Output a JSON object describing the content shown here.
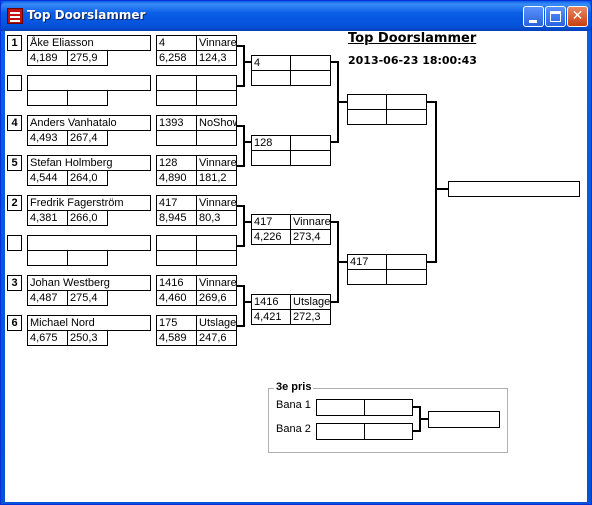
{
  "window": {
    "title": "Top Doorslammer"
  },
  "header": {
    "title": "Top Doorslammer",
    "timestamp": "2013-06-23 18:00:43"
  },
  "round1": [
    {
      "seed": "1",
      "name": "Åke Eliasson",
      "rt": "4,189",
      "et": "275,9",
      "result_a": "4",
      "result_b": "Vinnare",
      "result_c": "6,258",
      "result_d": "124,3"
    },
    {
      "seed": "",
      "name": "",
      "rt": "",
      "et": "",
      "result_a": "",
      "result_b": "",
      "result_c": "",
      "result_d": ""
    },
    {
      "seed": "4",
      "name": "Anders Vanhatalo",
      "rt": "4,493",
      "et": "267,4",
      "result_a": "1393",
      "result_b": "NoShow",
      "result_c": "",
      "result_d": ""
    },
    {
      "seed": "5",
      "name": "Stefan Holmberg",
      "rt": "4,544",
      "et": "264,0",
      "result_a": "128",
      "result_b": "Vinnare",
      "result_c": "4,890",
      "result_d": "181,2"
    },
    {
      "seed": "2",
      "name": "Fredrik Fagerström",
      "rt": "4,381",
      "et": "266,0",
      "result_a": "417",
      "result_b": "Vinnare",
      "result_c": "8,945",
      "result_d": "80,3"
    },
    {
      "seed": "",
      "name": "",
      "rt": "",
      "et": "",
      "result_a": "",
      "result_b": "",
      "result_c": "",
      "result_d": ""
    },
    {
      "seed": "3",
      "name": "Johan Westberg",
      "rt": "4,487",
      "et": "275,4",
      "result_a": "1416",
      "result_b": "Vinnare",
      "result_c": "4,460",
      "result_d": "269,6"
    },
    {
      "seed": "6",
      "name": "Michael Nord",
      "rt": "4,675",
      "et": "250,3",
      "result_a": "175",
      "result_b": "Utslagen",
      "result_c": "4,589",
      "result_d": "247,6"
    }
  ],
  "round2": [
    {
      "a": "4",
      "b": "",
      "c": "",
      "d": ""
    },
    {
      "a": "128",
      "b": "",
      "c": "",
      "d": ""
    },
    {
      "a": "417",
      "b": "Vinnare",
      "c": "4,226",
      "d": "273,4"
    },
    {
      "a": "1416",
      "b": "Utslagen",
      "c": "4,421",
      "d": "272,3"
    }
  ],
  "semis": [
    {
      "a": "",
      "b": "",
      "c": "",
      "d": ""
    },
    {
      "a": "417",
      "b": "",
      "c": "",
      "d": ""
    }
  ],
  "final": {
    "winner": ""
  },
  "third_place": {
    "label": "3e pris",
    "lane1_label": "Bana 1",
    "lane2_label": "Bana 2",
    "lane1_a": "",
    "lane1_b": "",
    "lane2_a": "",
    "lane2_b": "",
    "result": ""
  }
}
